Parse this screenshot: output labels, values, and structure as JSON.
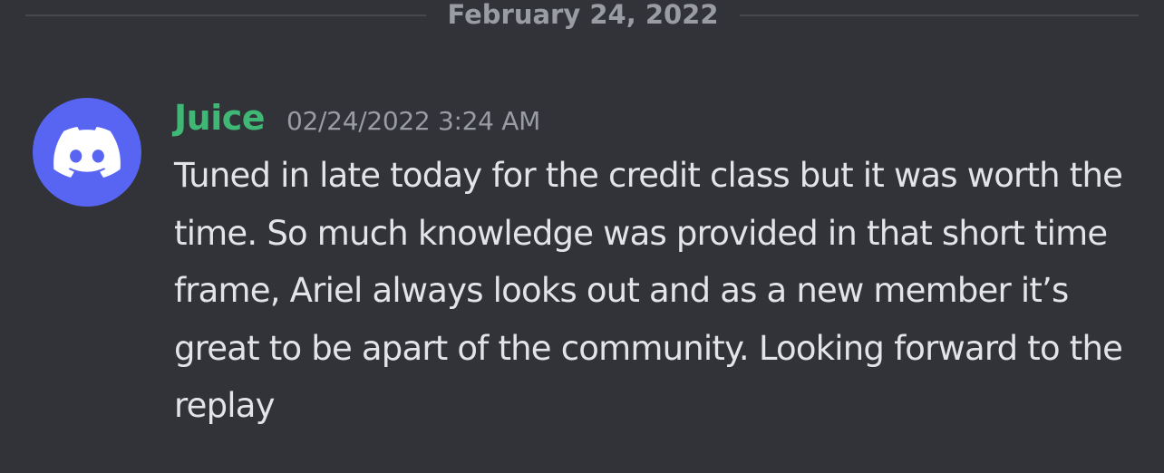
{
  "date_divider": {
    "label": "February 24, 2022"
  },
  "message": {
    "author": {
      "username": "Juice",
      "username_color": "#3fb876",
      "avatar_icon": "discord-logo-icon",
      "avatar_color": "#5865f2"
    },
    "timestamp": "02/24/2022 3:24 AM",
    "content": "Tuned in late today for the credit class but it was worth the time. So much knowledge was provided in that short time frame, Ariel always looks out and as a new member it’s great to be apart of the community. Looking forward to the replay"
  },
  "theme": {
    "background": "#313338",
    "text": "#e3e4e8",
    "muted": "#9a9ca3"
  }
}
